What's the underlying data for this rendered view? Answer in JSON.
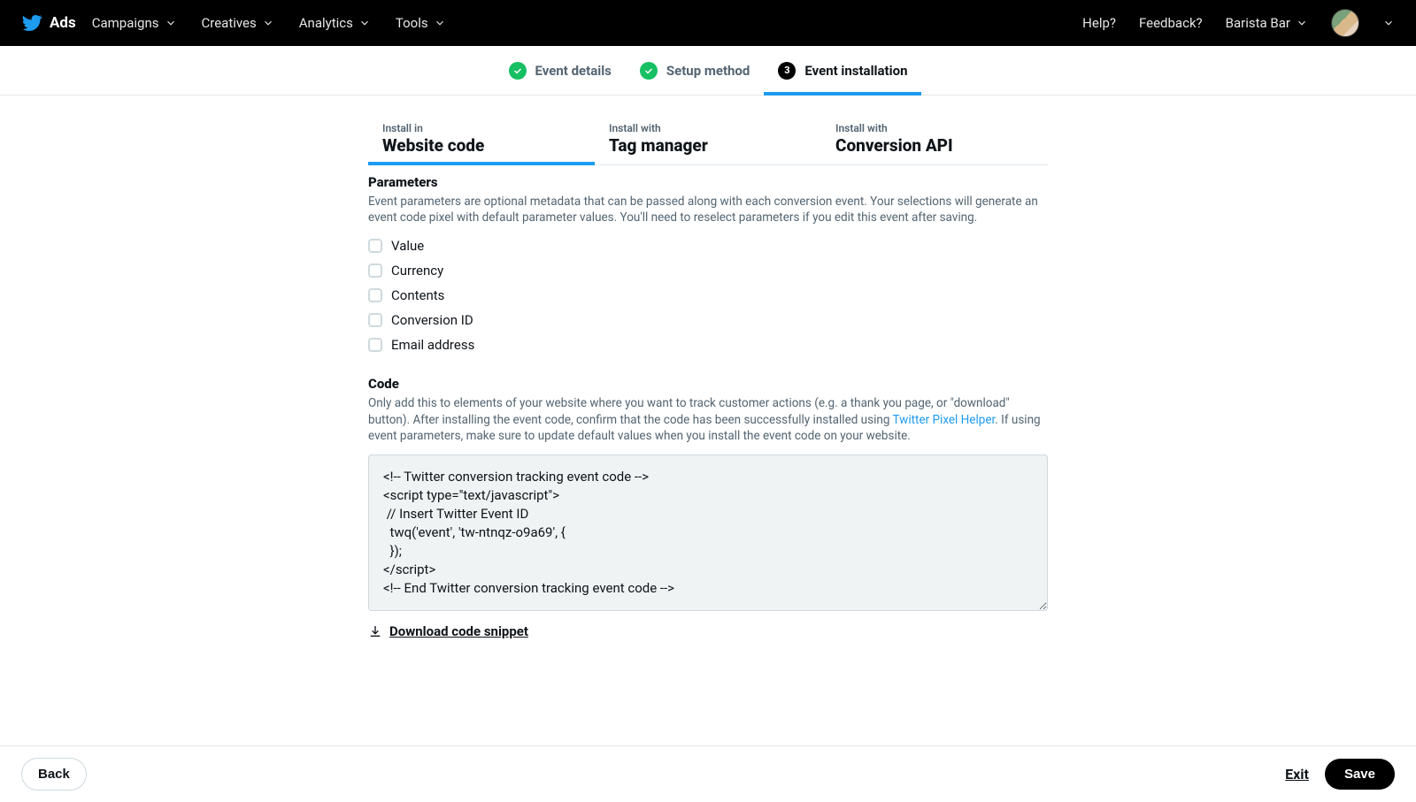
{
  "topnav": {
    "brand": "Ads",
    "left": [
      "Campaigns",
      "Creatives",
      "Analytics",
      "Tools"
    ],
    "right": {
      "help": "Help?",
      "feedback": "Feedback?",
      "account": "Barista Bar"
    }
  },
  "stepper": [
    {
      "label": "Event details",
      "state": "done"
    },
    {
      "label": "Setup method",
      "state": "done"
    },
    {
      "label": "Event installation",
      "state": "active",
      "num": "3"
    }
  ],
  "tabs": [
    {
      "sup": "Install in",
      "main": "Website code",
      "active": true
    },
    {
      "sup": "Install with",
      "main": "Tag manager",
      "active": false
    },
    {
      "sup": "Install with",
      "main": "Conversion API",
      "active": false
    }
  ],
  "parameters": {
    "title": "Parameters",
    "desc": "Event parameters are optional metadata that can be passed along with each conversion event. Your selections will generate an event code pixel with default parameter values. You'll need to reselect parameters if you edit this event after saving.",
    "items": [
      "Value",
      "Currency",
      "Contents",
      "Conversion ID",
      "Email address"
    ]
  },
  "code": {
    "title": "Code",
    "desc_pre": "Only add this to elements of your website where you want to track customer actions (e.g. a thank you page, or \"download\" button). After installing the event code, confirm that the code has been successfully installed using ",
    "desc_link": "Twitter Pixel Helper",
    "desc_post": ". If using event parameters, make sure to update default values when you install the event code on your website.",
    "snippet": "<!-- Twitter conversion tracking event code -->\n<script type=\"text/javascript\">\n // Insert Twitter Event ID\n  twq('event', 'tw-ntnqz-o9a69', {\n  });\n</script>\n<!-- End Twitter conversion tracking event code -->",
    "download": "Download code snippet"
  },
  "footer": {
    "back": "Back",
    "exit": "Exit",
    "save": "Save"
  }
}
